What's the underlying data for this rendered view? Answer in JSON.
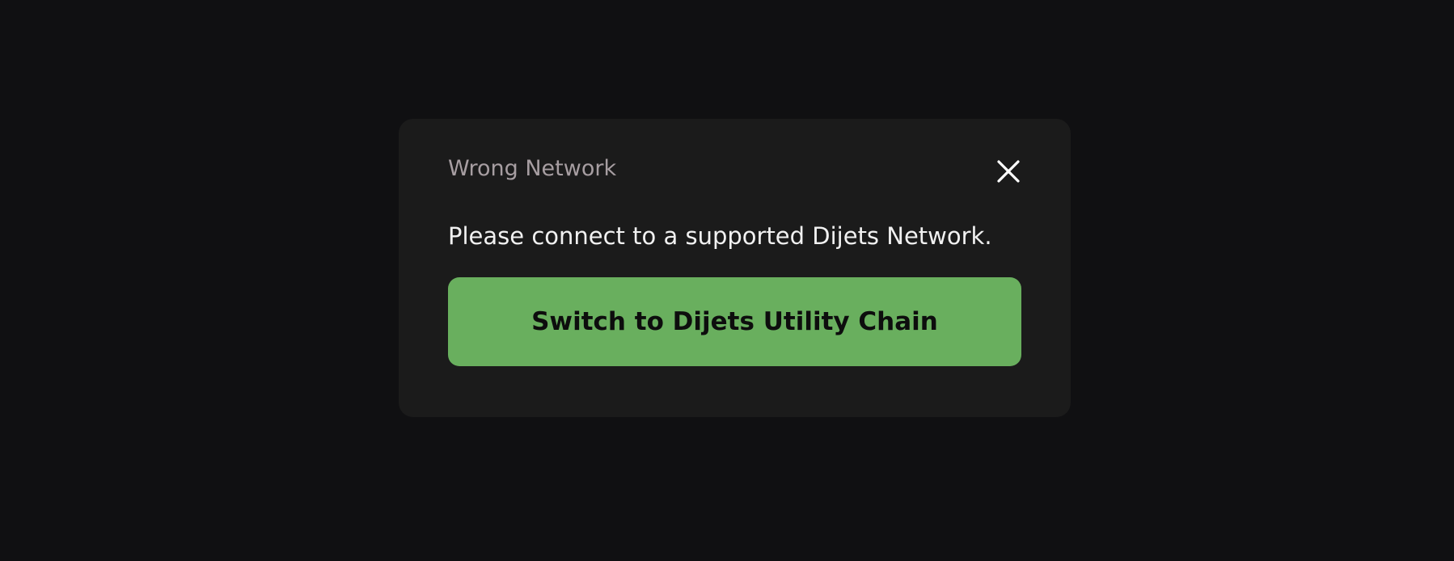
{
  "modal": {
    "title": "Wrong Network",
    "message": "Please connect to a supported Dijets Network.",
    "close_icon": "close-icon",
    "primary_button_label": "Switch to Dijets Utility Chain"
  },
  "colors": {
    "page_background": "#101012",
    "modal_background": "#1b1b1b",
    "title_text": "#a79ea2",
    "message_text": "#f1f1f1",
    "button_background": "#69af5e",
    "button_text": "#0d0d0d"
  }
}
